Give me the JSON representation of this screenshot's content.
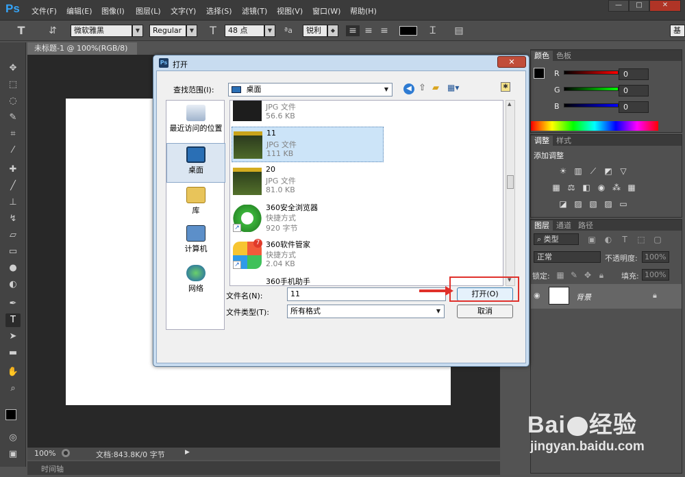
{
  "app": {
    "logo": "Ps",
    "menu": [
      "文件(F)",
      "编辑(E)",
      "图像(I)",
      "图层(L)",
      "文字(Y)",
      "选择(S)",
      "滤镜(T)",
      "视图(V)",
      "窗口(W)",
      "帮助(H)"
    ],
    "window_buttons": [
      "—",
      "□",
      "✕"
    ]
  },
  "options": {
    "tool_glyph": "T",
    "font_family": "微软雅黑",
    "font_style": "Regular",
    "font_size": "48 点",
    "aa_label": "ªa",
    "antialias": "锐利"
  },
  "document": {
    "tab_title": "未标题-1 @ 100%(RGB/8)",
    "tab_close": "✕",
    "zoom": "100%",
    "doc_info": "文档:843.8K/0 字节",
    "timeline_label": "时间轴"
  },
  "panels": {
    "color_tabs": [
      "颜色",
      "色板"
    ],
    "channels": [
      {
        "label": "R",
        "value": "0"
      },
      {
        "label": "G",
        "value": "0"
      },
      {
        "label": "B",
        "value": "0"
      }
    ],
    "adjust_tabs": [
      "调整",
      "样式"
    ],
    "adjust_title": "添加调整",
    "layers_tabs": [
      "图层",
      "通道",
      "路径"
    ],
    "layer_filter": "类型",
    "blend_mode": "正常",
    "opacity_label": "不透明度:",
    "opacity_value": "100%",
    "lock_label": "锁定:",
    "fill_label": "填充:",
    "fill_value": "100%",
    "layer_name": "背景"
  },
  "dialog": {
    "title": "打开",
    "ps_icon": "Ps",
    "close": "✕",
    "look_in_label": "查找范围(I):",
    "look_in_value": "桌面",
    "places": [
      {
        "label": "最近访问的位置"
      },
      {
        "label": "桌面"
      },
      {
        "label": "库"
      },
      {
        "label": "计算机"
      },
      {
        "label": "网络"
      }
    ],
    "files": [
      {
        "name": "",
        "type": "JPG 文件",
        "size": "56.6 KB"
      },
      {
        "name": "11",
        "type": "JPG 文件",
        "size": "111 KB"
      },
      {
        "name": "20",
        "type": "JPG 文件",
        "size": "81.0 KB"
      },
      {
        "name": "360安全浏览器",
        "type": "快捷方式",
        "size": "920 字节"
      },
      {
        "name": "360软件管家",
        "type": "快捷方式",
        "size": "2.04 KB"
      },
      {
        "name": "360手机助手",
        "type": "",
        "size": ""
      }
    ],
    "filename_label": "文件名(N):",
    "filename_value": "11",
    "filetype_label": "文件类型(T):",
    "filetype_value": "所有格式",
    "open_button": "打开(O)",
    "cancel_button": "取消",
    "badge_360": "7"
  },
  "watermark": {
    "brand": "Bai",
    "brand_suffix": "经验",
    "url": "jingyan.baidu.com"
  },
  "colors": {
    "dialog_title_bg": "#c8dcf0",
    "highlight_red": "#e0302a",
    "selection_blue": "#cce4f8"
  }
}
